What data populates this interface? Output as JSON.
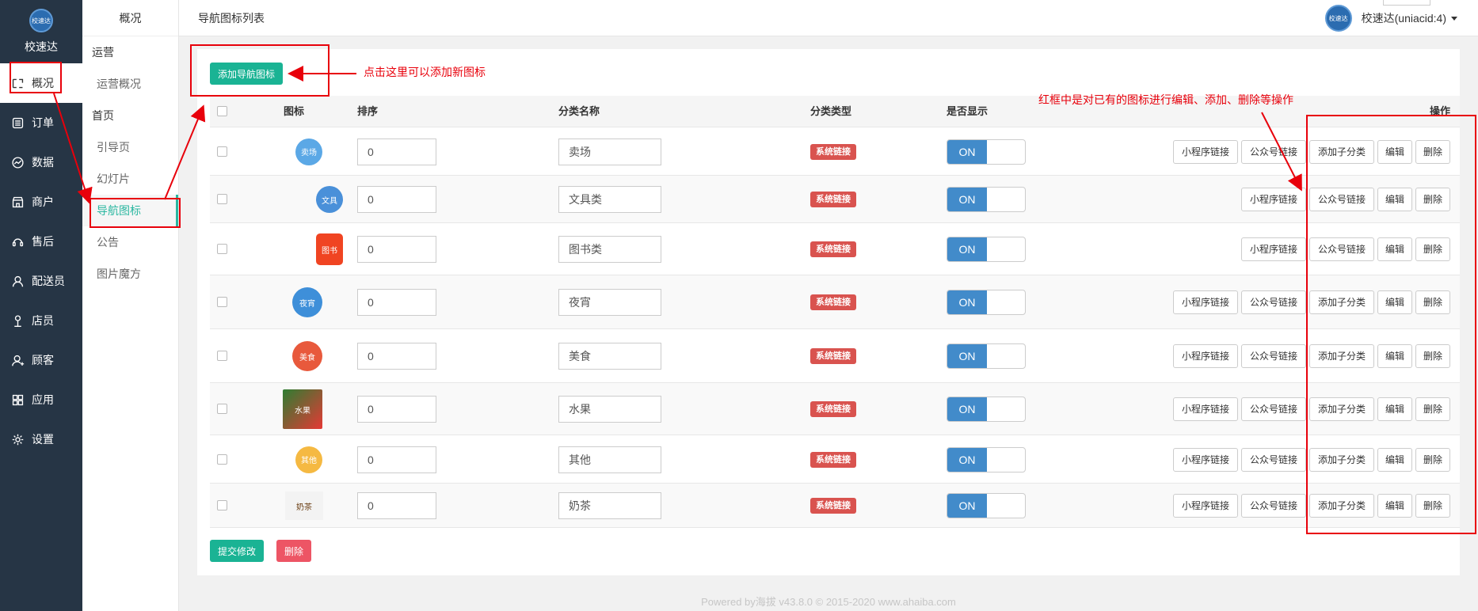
{
  "brand": {
    "name": "校速达",
    "logo_text": "校速达"
  },
  "sidebar": {
    "items": [
      {
        "label": "概况",
        "icon": "grid-icon"
      },
      {
        "label": "订单",
        "icon": "list-icon"
      },
      {
        "label": "数据",
        "icon": "chart-icon"
      },
      {
        "label": "商户",
        "icon": "store-icon"
      },
      {
        "label": "售后",
        "icon": "headset-icon"
      },
      {
        "label": "配送员",
        "icon": "user-icon"
      },
      {
        "label": "店员",
        "icon": "person-icon"
      },
      {
        "label": "顾客",
        "icon": "customer-icon"
      },
      {
        "label": "应用",
        "icon": "apps-icon"
      },
      {
        "label": "设置",
        "icon": "gear-icon"
      }
    ]
  },
  "subnav": {
    "title": "概况",
    "group1": "运营",
    "group1_items": [
      "运营概况"
    ],
    "group2": "首页",
    "group2_items": [
      "引导页",
      "幻灯片",
      "导航图标",
      "公告",
      "图片魔方"
    ]
  },
  "header": {
    "page_title": "导航图标列表",
    "user_name": "校速达(uniacid:4)",
    "avatar_text": "校速达"
  },
  "toolbar": {
    "add_label": "添加导航图标"
  },
  "table": {
    "headers": [
      "图标",
      "排序",
      "分类名称",
      "分类类型",
      "是否显示",
      "操作"
    ],
    "rows": [
      {
        "icon": "卖场",
        "sort": "0",
        "name": "卖场",
        "type": "系统链接",
        "show": "ON",
        "has_sub": true
      },
      {
        "icon": "文具",
        "sort": "0",
        "name": "文具类",
        "type": "系统链接",
        "show": "ON",
        "has_sub": false
      },
      {
        "icon": "图书",
        "sort": "0",
        "name": "图书类",
        "type": "系统链接",
        "show": "ON",
        "has_sub": false
      },
      {
        "icon": "夜宵",
        "sort": "0",
        "name": "夜宵",
        "type": "系统链接",
        "show": "ON",
        "has_sub": true
      },
      {
        "icon": "美食",
        "sort": "0",
        "name": "美食",
        "type": "系统链接",
        "show": "ON",
        "has_sub": true
      },
      {
        "icon": "水果",
        "sort": "0",
        "name": "水果",
        "type": "系统链接",
        "show": "ON",
        "has_sub": true
      },
      {
        "icon": "其他",
        "sort": "0",
        "name": "其他",
        "type": "系统链接",
        "show": "ON",
        "has_sub": true
      },
      {
        "icon": "奶茶",
        "sort": "0",
        "name": "奶茶",
        "type": "系统链接",
        "show": "ON",
        "has_sub": true
      }
    ],
    "actions": {
      "mini": "小程序链接",
      "mp": "公众号链接",
      "sub": "添加子分类",
      "edit": "编辑",
      "del": "删除"
    }
  },
  "footer_buttons": {
    "submit": "提交修改",
    "delete": "删除"
  },
  "footer": "Powered by海拔 v43.8.0 © 2015-2020 www.ahaiba.com",
  "annotations": {
    "add_hint": "点击这里可以添加新图标",
    "ops_hint": "红框中是对已有的图标进行编辑、添加、删除等操作"
  },
  "colors": {
    "sidebar_bg": "#263545",
    "primary": "#1ab394",
    "danger": "#ed5565",
    "switch_on": "#428bca",
    "tag": "#d9534f",
    "annotation": "#e8000b",
    "active_sub": "#29b7a0"
  },
  "row_icons": [
    "bubble-icon",
    "building-icon",
    "clipboard-icon",
    "moon-icon",
    "food-icon",
    "watermelon-icon",
    "chef-icon",
    "milk-tea-icon"
  ]
}
